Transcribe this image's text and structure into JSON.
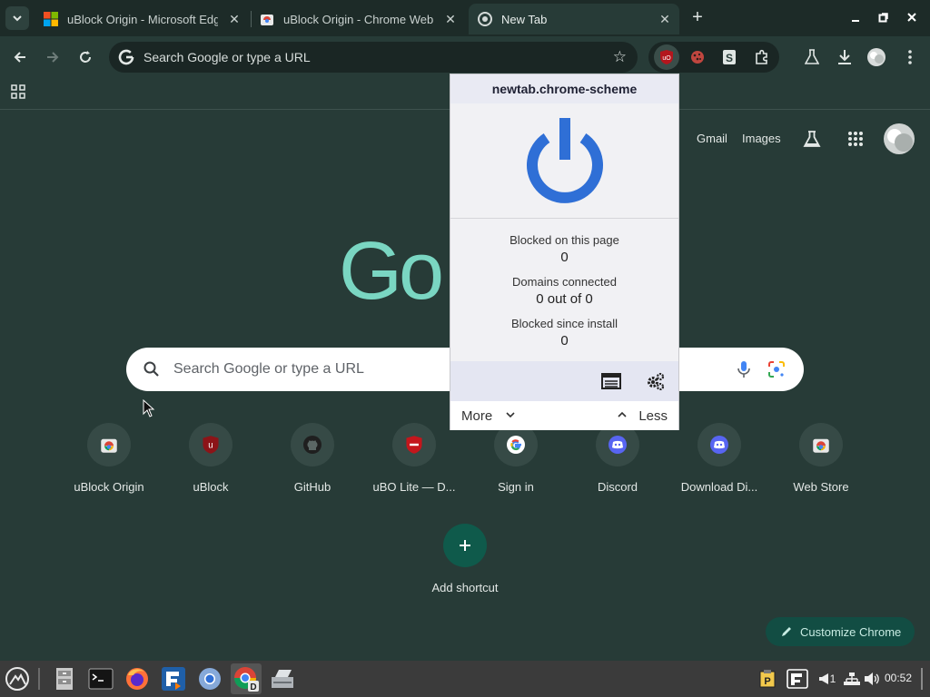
{
  "tabs": [
    {
      "title": "uBlock Origin - Microsoft Edge Add-ons"
    },
    {
      "title": "uBlock Origin - Chrome Web Store"
    },
    {
      "title": "New Tab"
    }
  ],
  "toolbar": {
    "omnibox_placeholder": "Search Google or type a URL"
  },
  "ntp": {
    "gmail": "Gmail",
    "images": "Images",
    "logo_text": "Go",
    "search_placeholder": "Search Google or type a URL",
    "shortcuts": [
      {
        "label": "uBlock Origin",
        "icon": "chrome-web-store-icon"
      },
      {
        "label": "uBlock",
        "icon": "ublock-icon"
      },
      {
        "label": "GitHub",
        "icon": "github-icon"
      },
      {
        "label": "uBO Lite — D...",
        "icon": "ubo-lite-icon"
      },
      {
        "label": "Sign in",
        "icon": "google-icon"
      },
      {
        "label": "Discord",
        "icon": "discord-icon"
      },
      {
        "label": "Download Di...",
        "icon": "discord-icon"
      },
      {
        "label": "Web Store",
        "icon": "chrome-web-store-icon"
      }
    ],
    "add_shortcut": "Add shortcut",
    "customize": "Customize Chrome"
  },
  "popup": {
    "hostname": "newtab.chrome-scheme",
    "blocked_page_label": "Blocked on this page",
    "blocked_page_value": "0",
    "domains_label": "Domains connected",
    "domains_value": "0 out of 0",
    "blocked_install_label": "Blocked since install",
    "blocked_install_value": "0",
    "more": "More",
    "less": "Less"
  },
  "taskbar": {
    "clock": "00:52",
    "workspace": "1"
  },
  "colors": {
    "accent": "#7ad6c2",
    "power_blue": "#2f6fd6",
    "ubo_red": "#b3161d"
  }
}
